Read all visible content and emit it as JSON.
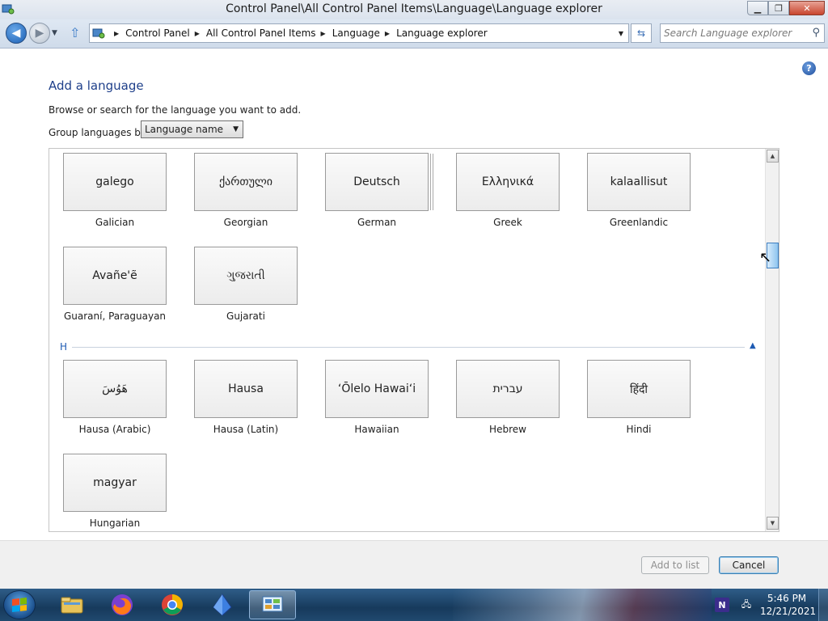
{
  "window": {
    "title": "Control Panel\\All Control Panel Items\\Language\\Language explorer",
    "controls": {
      "minimize": "▁",
      "maximize": "❐",
      "close": "✕"
    }
  },
  "addressbar": {
    "breadcrumbs": [
      "Control Panel",
      "All Control Panel Items",
      "Language",
      "Language explorer"
    ],
    "search_placeholder": "Search Language explorer"
  },
  "content": {
    "heading": "Add a language",
    "instruction": "Browse or search for the language you want to add.",
    "group_label": "Group languages by:",
    "group_value": "Language name",
    "section_h": "H",
    "tiles_g": [
      {
        "native": "galego",
        "label": "Galician"
      },
      {
        "native": "ქართული",
        "label": "Georgian"
      },
      {
        "native": "Deutsch",
        "label": "German"
      },
      {
        "native": "Ελληνικά",
        "label": "Greek"
      },
      {
        "native": "kalaallisut",
        "label": "Greenlandic"
      },
      {
        "native": "Avañe'ẽ",
        "label": "Guaraní, Paraguayan"
      },
      {
        "native": "ગુજરાતી",
        "label": "Gujarati"
      }
    ],
    "tiles_h": [
      {
        "native": "هَوُسَ",
        "label": "Hausa (Arabic)"
      },
      {
        "native": "Hausa",
        "label": "Hausa (Latin)"
      },
      {
        "native": "ʻŌlelo Hawaiʻi",
        "label": "Hawaiian"
      },
      {
        "native": "עברית",
        "label": "Hebrew"
      },
      {
        "native": "हिंदी",
        "label": "Hindi"
      },
      {
        "native": "magyar",
        "label": "Hungarian"
      }
    ]
  },
  "footer": {
    "add_label": "Add to list",
    "cancel_label": "Cancel"
  },
  "taskbar": {
    "time": "5:46 PM",
    "date": "12/21/2021",
    "colors": {
      "accent": "#1e5bb3",
      "taskbar": "#173a5c"
    }
  }
}
